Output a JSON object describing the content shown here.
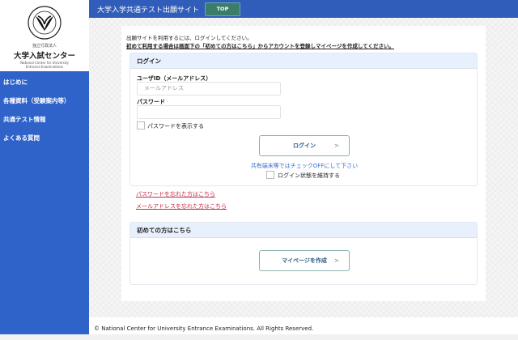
{
  "logo": {
    "circle_text": "NATIONAL CENTER FOR UNIVERSITY ENTRANCE EXAMINATIONS",
    "line1": "独立行政法人",
    "line2": "大学入試センター",
    "line3": "National Center for University",
    "line4": "Entrance Examinations"
  },
  "sidebar": {
    "items": [
      {
        "label": "はじめに"
      },
      {
        "label": "各種資料（受験案内等）"
      },
      {
        "label": "共通テスト情報"
      },
      {
        "label": "よくある質問"
      }
    ]
  },
  "header": {
    "title": "大学入学共通テスト出願サイト",
    "top_button": "TOP"
  },
  "main": {
    "intro": "出願サイトを利用するには、ログインしてください。",
    "intro_bold": "初めて利用する場合は画面下の「初めての方はこちら」からアカウントを登録しマイページを作成してください。",
    "login": {
      "title": "ログイン",
      "userid_label": "ユーザID（メールアドレス）",
      "userid_placeholder": "メールアドレス",
      "userid_value": "",
      "password_label": "パスワード",
      "password_value": "",
      "show_password": "パスワードを表示する",
      "login_button": "ログイン",
      "chevron": ">",
      "notice": "共有端末等ではチェックOFFにして下さい",
      "keep_login": "ログイン状態を維持する",
      "forgot_password": "パスワードを忘れた方はこちら",
      "forgot_email": "メールアドレスを忘れた方はこちら"
    },
    "first": {
      "title": "初めての方はこちら",
      "create_button": "マイページを作成"
    }
  },
  "footer": {
    "copyright": "© National Center for University Entrance Examinations. All Rights Reserved."
  },
  "colors": {
    "sidebar": "#2f63c9",
    "header": "#2f5db9",
    "top_button": "#3b7d6a",
    "link": "#c03048",
    "notice": "#2f6fd0"
  }
}
